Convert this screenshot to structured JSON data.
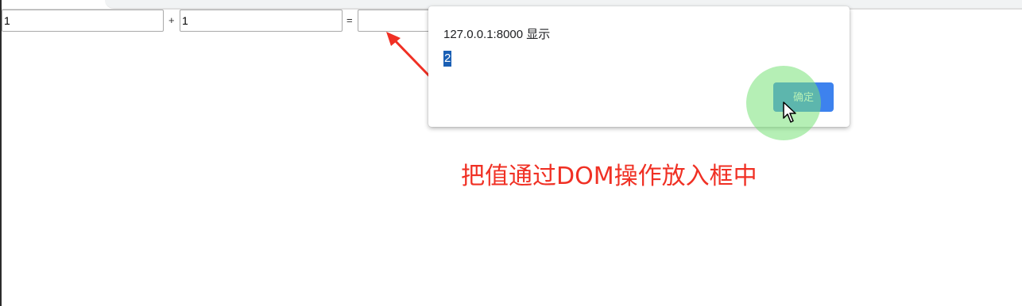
{
  "calculator": {
    "first_value": "1",
    "operator": "+",
    "second_value": "1",
    "equals": "=",
    "result_value": ""
  },
  "alert_dialog": {
    "origin_text": "127.0.0.1:8000 显示",
    "message": "2",
    "ok_label": "确定",
    "button_color": "#3d82ee"
  },
  "annotation": {
    "text": "把值通过DOM操作放入框中",
    "color": "#f03024"
  },
  "icons": {
    "arrow": "red-arrow-icon",
    "cursor": "mouse-pointer-icon"
  }
}
